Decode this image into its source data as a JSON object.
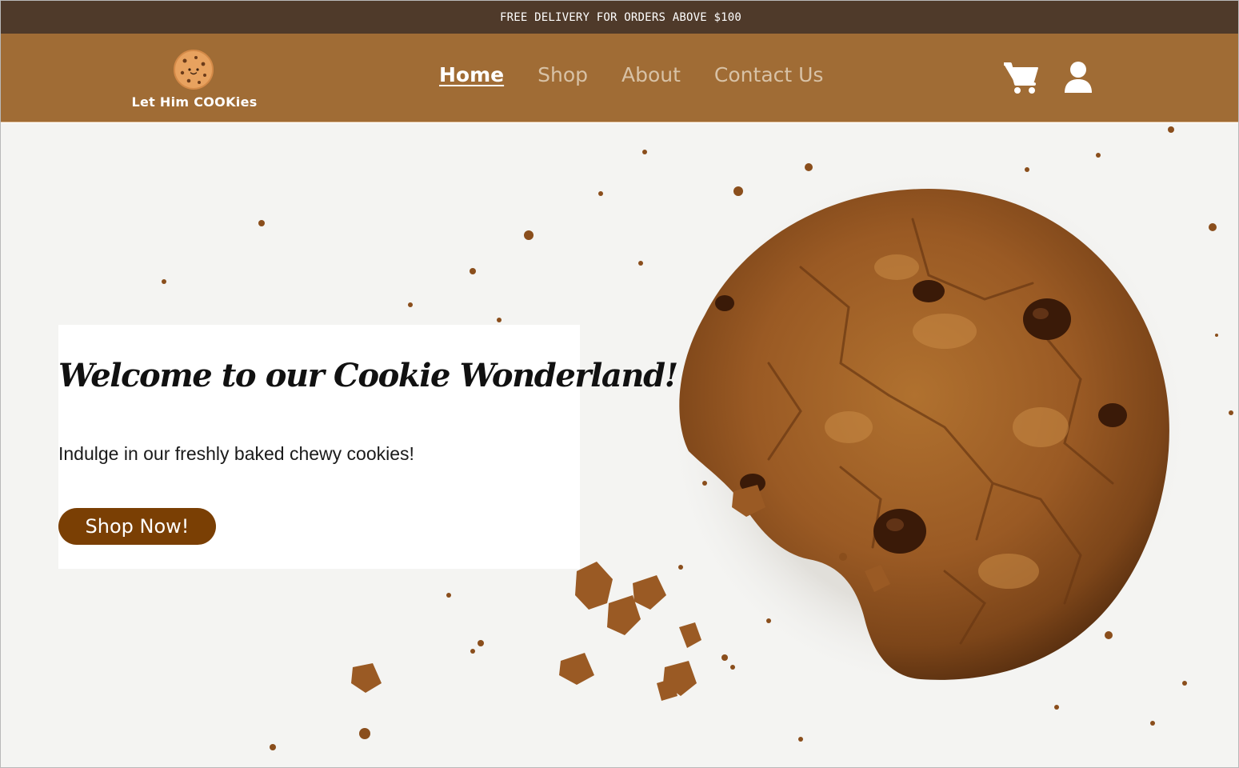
{
  "promo": {
    "text": "FREE DELIVERY FOR ORDERS ABOVE $100"
  },
  "header": {
    "logo_text": "Let Him COOKies",
    "nav": [
      {
        "label": "Home",
        "active": true
      },
      {
        "label": "Shop",
        "active": false
      },
      {
        "label": "About",
        "active": false
      },
      {
        "label": "Contact Us",
        "active": false
      }
    ],
    "icons": [
      "cart-icon",
      "user-icon"
    ]
  },
  "hero": {
    "title": "Welcome to our Cookie Wonderland!",
    "subtitle": "Indulge in our freshly baked chewy cookies!",
    "cta_label": "Shop Now!",
    "image": "bitten-chocolate-chip-cookie-photo"
  },
  "colors": {
    "promo_bg": "#4f3a2a",
    "header_bg": "#a06c35",
    "nav_active": "#ffffff",
    "nav_inactive": "#d8c2a6",
    "cta_bg": "#7a3f04",
    "hero_bg": "#f4f4f2"
  }
}
